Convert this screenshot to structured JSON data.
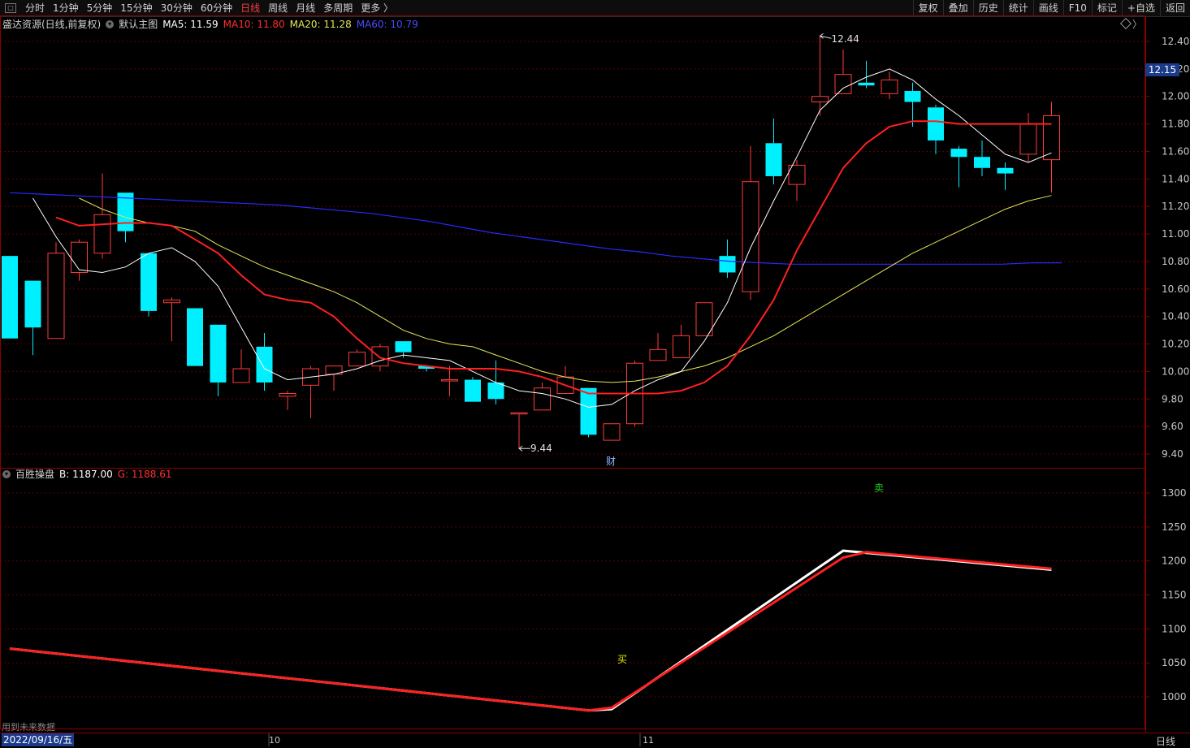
{
  "toolbar": {
    "periods": [
      "分时",
      "1分钟",
      "5分钟",
      "15分钟",
      "30分钟",
      "60分钟",
      "日线",
      "周线",
      "月线",
      "多周期",
      "更多 〉"
    ],
    "active_period": "日线",
    "right": [
      "复权",
      "叠加",
      "历史",
      "统计",
      "画线",
      "F10",
      "标记",
      "+自选",
      "返回"
    ]
  },
  "main": {
    "title": "盛达资源(日线,前复权)",
    "template": "默认主图",
    "ma": [
      {
        "label": "MA5: 11.59",
        "color": "#ffffff"
      },
      {
        "label": "MA10: 11.80",
        "color": "#ff3030"
      },
      {
        "label": "MA20: 11.28",
        "color": "#e6e65a"
      },
      {
        "label": "MA60: 10.79",
        "color": "#3a3aff"
      }
    ],
    "y_ticks": [
      "12.40",
      "12.20",
      "12.00",
      "11.80",
      "11.60",
      "11.40",
      "11.20",
      "11.00",
      "10.80",
      "10.60",
      "10.40",
      "10.20",
      "10.00",
      "9.80",
      "9.60",
      "9.40"
    ],
    "current_price": "12.15",
    "high_label": "12.44",
    "low_label": "9.44",
    "cai_mark": "财"
  },
  "sub": {
    "title": "百胜操盘",
    "b": "B: 1187.00",
    "g": "G: 1188.61",
    "y_ticks": [
      "1300",
      "1250",
      "1200",
      "1150",
      "1100",
      "1050",
      "1000"
    ],
    "buy_label": "买",
    "sell_label": "卖",
    "future_note": "用到未来数据"
  },
  "xaxis": {
    "date": "2022/09/16/五",
    "ticks": [
      "10",
      "11"
    ],
    "mode": "日线"
  },
  "chart_data": [
    {
      "type": "candlestick",
      "title": "盛达资源(日线,前复权)",
      "ylim": [
        9.35,
        12.5
      ],
      "candles": [
        {
          "o": 10.84,
          "h": 10.84,
          "l": 10.24,
          "c": 10.24
        },
        {
          "o": 10.66,
          "h": 10.66,
          "l": 10.12,
          "c": 10.32
        },
        {
          "o": 10.24,
          "h": 10.94,
          "l": 10.24,
          "c": 10.86
        },
        {
          "o": 10.72,
          "h": 10.96,
          "l": 10.66,
          "c": 10.94
        },
        {
          "o": 10.86,
          "h": 11.44,
          "l": 10.82,
          "c": 11.14
        },
        {
          "o": 11.3,
          "h": 11.3,
          "l": 10.94,
          "c": 11.02
        },
        {
          "o": 10.86,
          "h": 10.86,
          "l": 10.4,
          "c": 10.44
        },
        {
          "o": 10.5,
          "h": 10.54,
          "l": 10.22,
          "c": 10.52
        },
        {
          "o": 10.46,
          "h": 10.46,
          "l": 10.04,
          "c": 10.04
        },
        {
          "o": 10.34,
          "h": 10.34,
          "l": 9.82,
          "c": 9.92
        },
        {
          "o": 9.92,
          "h": 10.16,
          "l": 9.92,
          "c": 10.02
        },
        {
          "o": 10.18,
          "h": 10.28,
          "l": 9.86,
          "c": 9.92
        },
        {
          "o": 9.82,
          "h": 9.86,
          "l": 9.72,
          "c": 9.84
        },
        {
          "o": 9.9,
          "h": 10.04,
          "l": 9.66,
          "c": 10.02
        },
        {
          "o": 9.98,
          "h": 10.04,
          "l": 9.86,
          "c": 10.04
        },
        {
          "o": 10.04,
          "h": 10.16,
          "l": 10.04,
          "c": 10.14
        },
        {
          "o": 10.04,
          "h": 10.2,
          "l": 10.0,
          "c": 10.18
        },
        {
          "o": 10.22,
          "h": 10.22,
          "l": 10.1,
          "c": 10.14
        },
        {
          "o": 10.04,
          "h": 10.04,
          "l": 10.0,
          "c": 10.02
        },
        {
          "o": 9.94,
          "h": 10.04,
          "l": 9.82,
          "c": 9.94
        },
        {
          "o": 9.94,
          "h": 9.96,
          "l": 9.78,
          "c": 9.78
        },
        {
          "o": 9.92,
          "h": 10.08,
          "l": 9.76,
          "c": 9.8
        },
        {
          "o": 9.7,
          "h": 9.7,
          "l": 9.44,
          "c": 9.7
        },
        {
          "o": 9.72,
          "h": 9.92,
          "l": 9.72,
          "c": 9.88
        },
        {
          "o": 9.84,
          "h": 10.04,
          "l": 9.84,
          "c": 9.96
        },
        {
          "o": 9.88,
          "h": 9.88,
          "l": 9.52,
          "c": 9.54
        },
        {
          "o": 9.5,
          "h": 9.62,
          "l": 9.5,
          "c": 9.62
        },
        {
          "o": 9.62,
          "h": 10.08,
          "l": 9.6,
          "c": 10.06
        },
        {
          "o": 10.08,
          "h": 10.28,
          "l": 10.08,
          "c": 10.16
        },
        {
          "o": 10.1,
          "h": 10.34,
          "l": 10.1,
          "c": 10.26
        },
        {
          "o": 10.26,
          "h": 10.5,
          "l": 10.26,
          "c": 10.5
        },
        {
          "o": 10.84,
          "h": 10.96,
          "l": 10.68,
          "c": 10.72
        },
        {
          "o": 10.58,
          "h": 11.64,
          "l": 10.52,
          "c": 11.38
        },
        {
          "o": 11.66,
          "h": 11.84,
          "l": 11.36,
          "c": 11.42
        },
        {
          "o": 11.36,
          "h": 11.54,
          "l": 11.24,
          "c": 11.5
        },
        {
          "o": 11.96,
          "h": 12.44,
          "l": 11.86,
          "c": 12.0
        },
        {
          "o": 12.02,
          "h": 12.34,
          "l": 12.02,
          "c": 12.16
        },
        {
          "o": 12.1,
          "h": 12.26,
          "l": 12.06,
          "c": 12.08
        },
        {
          "o": 12.02,
          "h": 12.18,
          "l": 11.98,
          "c": 12.12
        },
        {
          "o": 12.04,
          "h": 12.1,
          "l": 11.78,
          "c": 11.96
        },
        {
          "o": 11.92,
          "h": 11.94,
          "l": 11.58,
          "c": 11.68
        },
        {
          "o": 11.62,
          "h": 11.64,
          "l": 11.34,
          "c": 11.56
        },
        {
          "o": 11.56,
          "h": 11.68,
          "l": 11.42,
          "c": 11.48
        },
        {
          "o": 11.48,
          "h": 11.52,
          "l": 11.32,
          "c": 11.44
        },
        {
          "o": 11.58,
          "h": 11.88,
          "l": 11.52,
          "c": 11.8
        },
        {
          "o": 11.54,
          "h": 11.96,
          "l": 11.3,
          "c": 11.86
        }
      ],
      "ma5": [
        11.26,
        10.98,
        10.74,
        10.72,
        10.76,
        10.86,
        10.9,
        10.8,
        10.62,
        10.32,
        10.02,
        9.94,
        9.96,
        9.98,
        10.02,
        10.08,
        10.12,
        10.1,
        10.08,
        10.0,
        9.92,
        9.86,
        9.84,
        9.8,
        9.74,
        9.76,
        9.86,
        9.94,
        10.0,
        10.22,
        10.5,
        10.9,
        11.24,
        11.56,
        11.9,
        12.06,
        12.14,
        12.2,
        12.12,
        11.98,
        11.86,
        11.72,
        11.58,
        11.52,
        11.59
      ],
      "ma10": [
        11.12,
        11.06,
        11.07,
        11.08,
        11.08,
        11.06,
        10.96,
        10.86,
        10.7,
        10.56,
        10.52,
        10.5,
        10.4,
        10.24,
        10.1,
        10.06,
        10.04,
        10.02,
        10.02,
        10.02,
        10.0,
        9.96,
        9.9,
        9.84,
        9.84,
        9.84,
        9.84,
        9.86,
        9.92,
        10.04,
        10.26,
        10.52,
        10.88,
        11.18,
        11.48,
        11.66,
        11.78,
        11.82,
        11.82,
        11.8,
        11.8,
        11.8,
        11.8,
        11.8
      ],
      "ma20": [
        11.26,
        11.18,
        11.12,
        11.08,
        11.06,
        11.02,
        10.92,
        10.84,
        10.76,
        10.7,
        10.64,
        10.58,
        10.5,
        10.4,
        10.3,
        10.24,
        10.2,
        10.18,
        10.12,
        10.06,
        10.0,
        9.96,
        9.93,
        9.92,
        9.93,
        9.96,
        10.0,
        10.04,
        10.1,
        10.18,
        10.26,
        10.36,
        10.46,
        10.56,
        10.66,
        10.76,
        10.86,
        10.94,
        11.02,
        11.1,
        11.18,
        11.24,
        11.28
      ],
      "ma60": [
        11.3,
        11.29,
        11.28,
        11.27,
        11.26,
        11.25,
        11.24,
        11.23,
        11.22,
        11.21,
        11.19,
        11.17,
        11.15,
        11.12,
        11.09,
        11.05,
        11.01,
        10.98,
        10.95,
        10.92,
        10.89,
        10.87,
        10.84,
        10.82,
        10.8,
        10.79,
        10.78,
        10.78,
        10.78,
        10.78,
        10.78,
        10.78,
        10.78,
        10.78,
        10.79,
        10.79
      ],
      "y_ticks": [
        12.4,
        12.2,
        12.0,
        11.8,
        11.6,
        11.4,
        11.2,
        11.0,
        10.8,
        10.6,
        10.4,
        10.2,
        10.0,
        9.8,
        9.6,
        9.4
      ]
    },
    {
      "type": "line",
      "title": "百胜操盘",
      "ylim": [
        950,
        1330
      ],
      "series": [
        {
          "name": "B",
          "color": "#ffffff",
          "points": [
            [
              0,
              1071
            ],
            [
              25,
              980
            ],
            [
              26,
              982
            ],
            [
              36,
              1215
            ],
            [
              45,
              1187
            ]
          ]
        },
        {
          "name": "G",
          "color": "#ff2020",
          "points": [
            [
              0,
              1071
            ],
            [
              25,
              980
            ],
            [
              26,
              984
            ],
            [
              36,
              1205
            ],
            [
              37,
              1213
            ],
            [
              45,
              1188.61
            ]
          ]
        }
      ],
      "y_ticks": [
        1300,
        1250,
        1200,
        1150,
        1100,
        1050,
        1000
      ]
    }
  ],
  "colors": {
    "up": "#ff3b3b",
    "down": "#00f0ff",
    "grid": "#5a0000",
    "axis": "#8b0000"
  }
}
